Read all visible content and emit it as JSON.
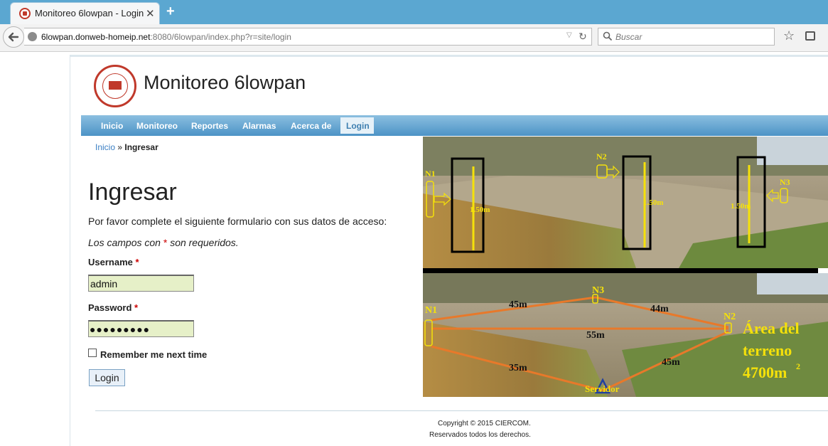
{
  "browser": {
    "tab_title": "Monitoreo 6lowpan - Login",
    "url_host": "6lowpan.donweb-homeip.net",
    "url_rest": ":8080/6lowpan/index.php?r=site/login",
    "search_placeholder": "Buscar"
  },
  "site": {
    "title": "Monitoreo 6lowpan",
    "menu": [
      "Inicio",
      "Monitoreo",
      "Reportes",
      "Alarmas",
      "Acerca de",
      "Login"
    ],
    "active_menu": "Login"
  },
  "breadcrumb": {
    "home": "Inicio",
    "sep": "»",
    "current": "Ingresar"
  },
  "login": {
    "heading": "Ingresar",
    "instructions": "Por favor complete el siguiente formulario con sus datos de acceso:",
    "required_note_pre": "Los campos con",
    "required_mark": "*",
    "required_note_post": "son requeridos.",
    "username_label": "Username",
    "username_value": "admin",
    "password_label": "Password",
    "password_masked": "●●●●●●●●●",
    "remember_label": "Remember me next time",
    "remember_checked": false,
    "submit_label": "Login"
  },
  "photo": {
    "top_nodes": [
      "N1",
      "N2",
      "N3"
    ],
    "heights": [
      "1.50m",
      "1.50m",
      "1.50m"
    ],
    "bottom_nodes": [
      "N1",
      "N3",
      "N2"
    ],
    "distances": [
      "45m",
      "44m",
      "55m",
      "35m",
      "45m"
    ],
    "server": "Servidor",
    "area_line1": "Área del",
    "area_line2": "terreno",
    "area_line3": "4700m",
    "area_sup": "2"
  },
  "footer": {
    "copyright": "Copyright © 2015 CIERCOM.",
    "rights": "Reservados todos los derechos."
  }
}
